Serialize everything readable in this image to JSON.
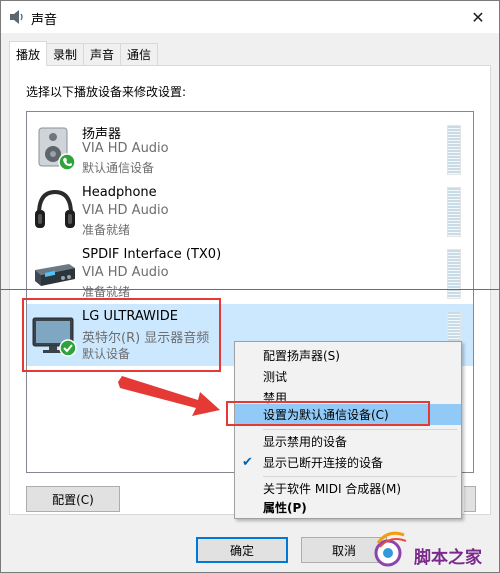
{
  "window": {
    "title": "声音",
    "close_glyph": "✕"
  },
  "tabs": [
    {
      "label": "播放",
      "active": true
    },
    {
      "label": "录制"
    },
    {
      "label": "声音"
    },
    {
      "label": "通信"
    }
  ],
  "panel": {
    "instruction": "选择以下播放设备来修改设置:"
  },
  "devices": [
    {
      "name": "扬声器",
      "driver": "VIA HD Audio",
      "status": "默认通信设备",
      "icon": "speaker-icon"
    },
    {
      "name": "Headphone",
      "driver": "VIA HD Audio",
      "status": "准备就绪",
      "icon": "headphone-icon"
    },
    {
      "name": "SPDIF Interface (TX0)",
      "driver": "VIA HD Audio",
      "status": "准备就绪",
      "icon": "spdif-icon"
    },
    {
      "name": "LG ULTRAWIDE",
      "driver": "英特尔(R) 显示器音频",
      "status": "默认设备",
      "icon": "monitor-icon",
      "selected": true
    }
  ],
  "buttons": {
    "configure": "配置(C)",
    "ok": "确定",
    "cancel": "取消"
  },
  "context_menu": {
    "items": [
      {
        "label": "配置扬声器(S)"
      },
      {
        "label": "测试"
      },
      {
        "label": "禁用"
      },
      {
        "label": "设置为默认通信设备(C)",
        "highlighted": true
      },
      {
        "label": "显示禁用的设备"
      },
      {
        "label": "显示已断开连接的设备",
        "checked": true
      },
      {
        "label": "关于软件 MIDI 合成器(M)"
      },
      {
        "label": "属性(P)",
        "bold": true
      }
    ]
  },
  "watermark": {
    "text": "脚本之家"
  },
  "colors": {
    "accent": "#0078d7",
    "selection": "#cce8ff",
    "annotation_red": "#e53935",
    "status_green": "#2fa33b"
  }
}
